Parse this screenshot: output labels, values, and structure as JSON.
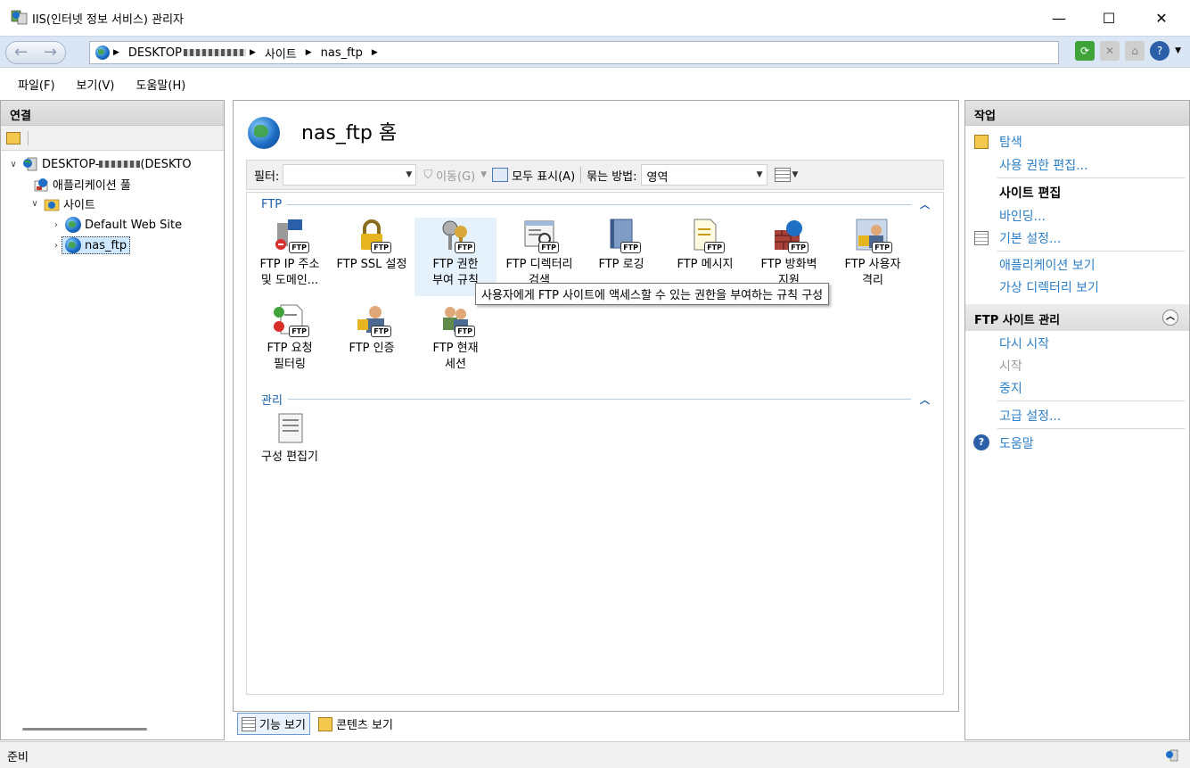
{
  "window": {
    "title": "IIS(인터넷 정보 서비스) 관리자",
    "minimize": "—",
    "maximize": "☐",
    "close": "✕"
  },
  "address": {
    "crumbs": [
      "DESKTOP",
      "사이트",
      "nas_ftp"
    ]
  },
  "menu": {
    "items": [
      "파일(F)",
      "보기(V)",
      "도움말(H)"
    ]
  },
  "left": {
    "header": "연결",
    "tree": {
      "server": "DESKTOP-",
      "server_suffix": "(DESKTO",
      "app_pools": "애플리케이션 풀",
      "sites": "사이트",
      "default_site": "Default Web Site",
      "nas_ftp": "nas_ftp"
    }
  },
  "center": {
    "title": "nas_ftp 홈",
    "filter_label": "필터:",
    "go_label": "이동(G)",
    "show_all_label": "모두 표시(A)",
    "group_by_label": "묶는 방법:",
    "group_by_value": "영역",
    "groups": [
      {
        "name": "FTP",
        "features": [
          {
            "line1": "FTP IP 주소",
            "line2": "및 도메인..."
          },
          {
            "line1": "FTP SSL 설정",
            "line2": ""
          },
          {
            "line1": "FTP 권한",
            "line2": "부여 규칙"
          },
          {
            "line1": "FTP 디렉터리",
            "line2": "검색"
          },
          {
            "line1": "FTP 로깅",
            "line2": ""
          },
          {
            "line1": "FTP 메시지",
            "line2": ""
          },
          {
            "line1": "FTP 방화벽",
            "line2": "지원"
          },
          {
            "line1": "FTP 사용자",
            "line2": "격리"
          },
          {
            "line1": "FTP 요청",
            "line2": "필터링"
          },
          {
            "line1": "FTP 인증",
            "line2": ""
          },
          {
            "line1": "FTP 현재",
            "line2": "세션"
          }
        ]
      },
      {
        "name": "관리",
        "features": [
          {
            "line1": "구성 편집기",
            "line2": ""
          }
        ]
      }
    ],
    "tooltip": "사용자에게 FTP 사이트에 액세스할 수 있는 권한을 부여하는 규칙 구성",
    "view_tabs": [
      "기능 보기",
      "콘텐츠 보기"
    ]
  },
  "right": {
    "header": "작업",
    "explore": "탐색",
    "edit_permissions": "사용 권한 편집...",
    "site_edit_title": "사이트 편집",
    "bindings": "바인딩...",
    "basic_settings": "기본 설정...",
    "view_applications": "애플리케이션 보기",
    "view_virtual_dirs": "가상 디렉터리 보기",
    "ftp_manage_title": "FTP 사이트 관리",
    "restart": "다시 시작",
    "start": "시작",
    "stop": "중지",
    "advanced_settings": "고급 설정...",
    "help": "도움말"
  },
  "status": {
    "text": "준비"
  },
  "colors": {
    "link": "#2d7fc7",
    "group_header": "#1c5ea8",
    "selection": "#cde8ff",
    "hover": "#e5f1fb"
  }
}
